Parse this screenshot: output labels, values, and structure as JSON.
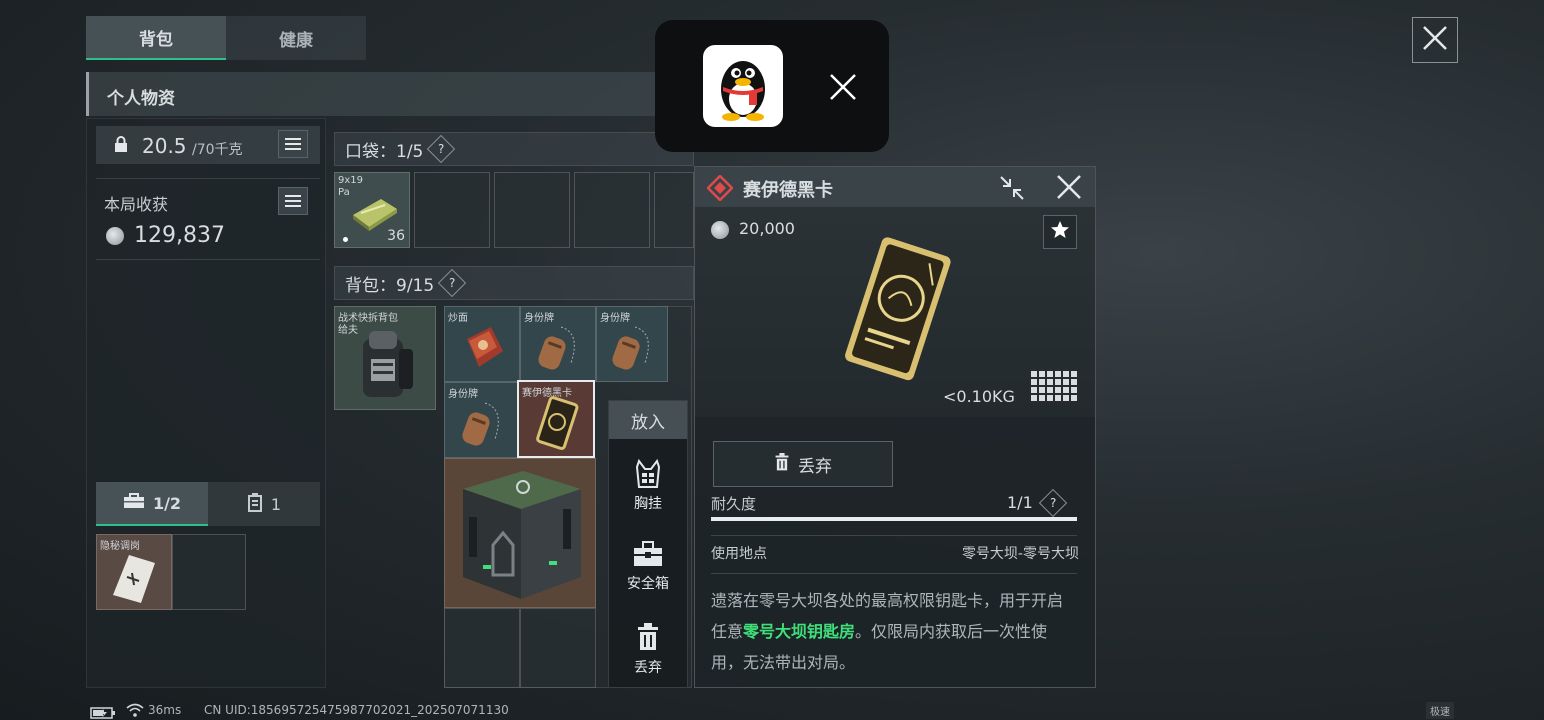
{
  "tabs": [
    {
      "label": "背包",
      "active": true
    },
    {
      "label": "健康",
      "active": false
    }
  ],
  "section_title": "个人物资",
  "weight": {
    "current": "20.5",
    "max": "/70千克"
  },
  "harvest": {
    "label": "本局收获",
    "value": "129,837"
  },
  "pocket": {
    "label": "口袋：1/5",
    "help": "?"
  },
  "pocket_item": {
    "label_line1": "9x19",
    "label_line2": "Pa",
    "count": "36"
  },
  "backpack": {
    "label": "背包：9/15",
    "help": "?"
  },
  "backpack_item": {
    "label": "战术快拆背包",
    "label_line2": "给夫"
  },
  "items": [
    {
      "label": "炒面"
    },
    {
      "label": "身份牌"
    },
    {
      "label": "身份牌"
    },
    {
      "label": "身份牌"
    },
    {
      "label": "赛伊德黑卡"
    }
  ],
  "safebox_tabs": [
    {
      "label": "1/2",
      "icon": "briefcase-icon"
    },
    {
      "label": "1",
      "icon": "canister-icon"
    }
  ],
  "safebox_item": {
    "label": "隐秘调岗"
  },
  "context_menu": {
    "title": "放入",
    "options": [
      {
        "label": "胸挂",
        "icon": "vest-icon"
      },
      {
        "label": "安全箱",
        "icon": "safebox-icon"
      },
      {
        "label": "丢弃",
        "icon": "trash-icon"
      }
    ]
  },
  "detail": {
    "title": "赛伊德黑卡",
    "price": "20,000",
    "weight": "<0.10KG",
    "discard_label": "丢弃",
    "durability_label": "耐久度",
    "durability_value": "1/1",
    "durability_help": "?",
    "durability_fraction": 1.0,
    "location_label": "使用地点",
    "location_value": "零号大坝-零号大坝",
    "desc_part1": "遗落在零号大坝各处的最高权限钥匙卡，用于开启任意",
    "desc_highlight": "零号大坝钥匙房",
    "desc_part2": "。仅限局内获取后一次性使用，无法带出对局。",
    "highlight_color": "#3fe07a"
  },
  "status_bar": {
    "ping": "36ms",
    "uid": "CN UID:185695725475987702021_202507071130",
    "corner": "极速"
  },
  "colors": {
    "accent_green": "#3fe07a",
    "tab_active_line": "#2fbf8a",
    "selected_border": "#e8ecee",
    "rare_red": "#e04a4a"
  }
}
